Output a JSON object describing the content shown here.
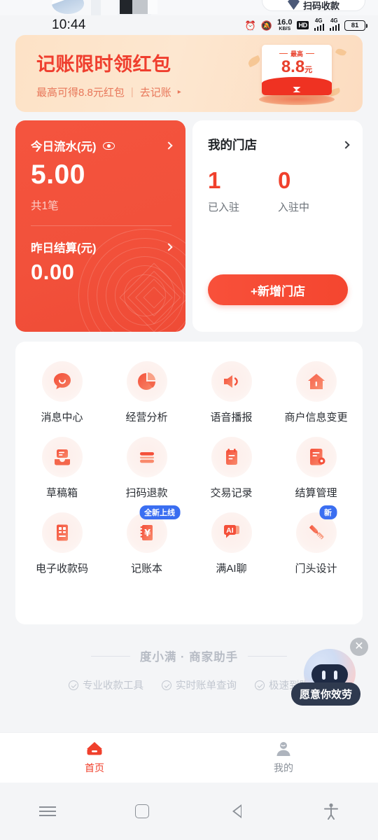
{
  "peek": {
    "scan_pay_label": "扫码收款"
  },
  "status_bar": {
    "time": "10:44",
    "alarm_icon": "alarm-clock-icon",
    "mute_icon": "bell-muted-icon",
    "net_speed_value": "16.0",
    "net_speed_unit": "KB/S",
    "hd_badge": "HD",
    "sim1_network": "4G",
    "sim2_network": "4G",
    "battery_percent": "81"
  },
  "banner": {
    "title": "记账限时领红包",
    "subtitle": "最高可得8.8元红包",
    "separator": "|",
    "cta": "去记账",
    "art_top_label": "最高",
    "art_amount": "8.8",
    "art_unit": "元"
  },
  "today_card": {
    "label": "今日流水(元)",
    "eye_icon": "eye-icon",
    "amount": "5.00",
    "count_text": "共1笔",
    "yesterday_label": "昨日结算(元)",
    "yesterday_amount": "0.00",
    "chevron_icon": "chevron-right-icon"
  },
  "store_card": {
    "title": "我的门店",
    "chevron_icon": "chevron-right-icon",
    "stats": [
      {
        "value": "1",
        "caption": "已入驻"
      },
      {
        "value": "0",
        "caption": "入驻中"
      }
    ],
    "add_button": "+新增门店"
  },
  "grid": {
    "items": [
      {
        "label": "消息中心",
        "icon": "message-bubble-icon",
        "badge": null
      },
      {
        "label": "经营分析",
        "icon": "pie-chart-icon",
        "badge": null
      },
      {
        "label": "语音播报",
        "icon": "speaker-icon",
        "badge": null
      },
      {
        "label": "商户信息变更",
        "icon": "house-icon",
        "badge": null
      },
      {
        "label": "草稿箱",
        "icon": "drafts-inbox-icon",
        "badge": null
      },
      {
        "label": "扫码退款",
        "icon": "refund-lines-icon",
        "badge": null
      },
      {
        "label": "交易记录",
        "icon": "transaction-note-icon",
        "badge": null
      },
      {
        "label": "结算管理",
        "icon": "settlement-doc-icon",
        "badge": null
      },
      {
        "label": "电子收款码",
        "icon": "qr-code-icon",
        "badge": null
      },
      {
        "label": "记账本",
        "icon": "ledger-yuan-icon",
        "badge": "全新上线"
      },
      {
        "label": "满AI聊",
        "icon": "ai-chat-icon",
        "badge": null
      },
      {
        "label": "门头设计",
        "icon": "pen-ruler-icon",
        "badge": "新"
      }
    ]
  },
  "brand": {
    "name": "度小满 · 商家助手",
    "features": [
      "专业收款工具",
      "实时账单查询",
      "极速到账"
    ]
  },
  "assistant": {
    "bubble_text": "愿意你效劳",
    "close_icon": "close-icon",
    "avatar_icon": "robot-avatar-icon"
  },
  "tabbar": {
    "tabs": [
      {
        "label": "首页",
        "icon": "home-icon",
        "active": true
      },
      {
        "label": "我的",
        "icon": "person-icon",
        "active": false
      }
    ]
  },
  "android_nav": {
    "menu_icon": "menu-icon",
    "home_icon": "square-home-icon",
    "back_icon": "back-triangle-icon",
    "accessibility_icon": "accessibility-icon"
  },
  "colors": {
    "brand_red": "#f0402c",
    "card_red": "#f2513b",
    "banner_peach": "#fde2c6",
    "badge_blue": "#3b6ff2",
    "page_bg": "#f4f5f7"
  }
}
